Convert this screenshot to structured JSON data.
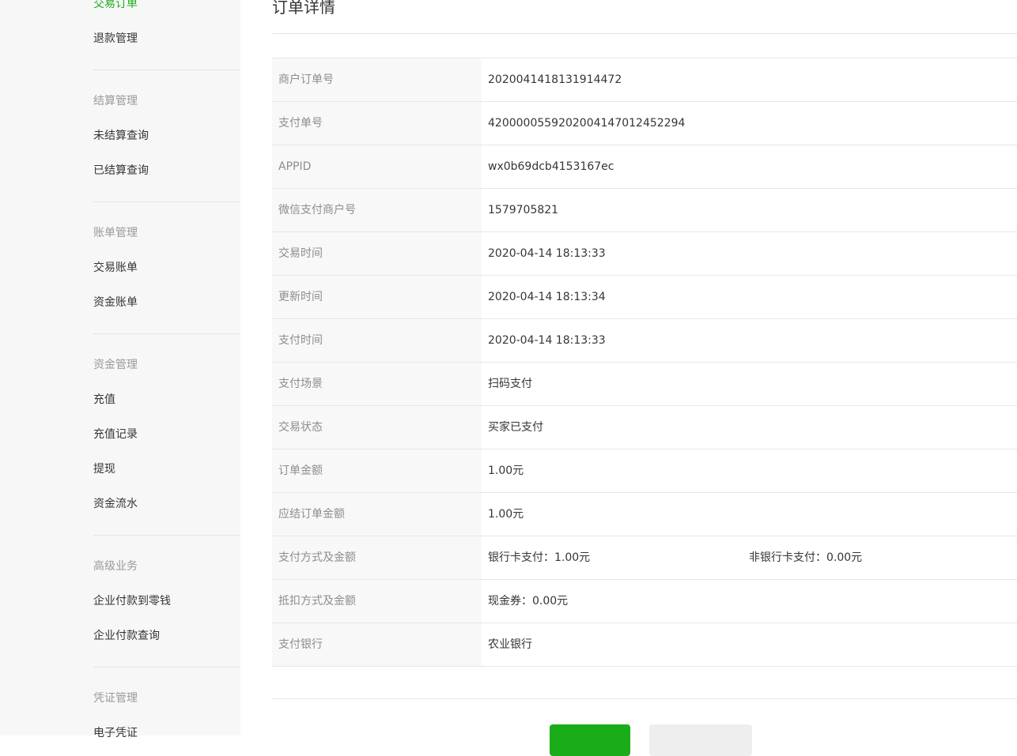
{
  "sidebar": {
    "top_items": [
      "交易订单",
      "退款管理"
    ],
    "groups": [
      {
        "title": "结算管理",
        "items": [
          "未结算查询",
          "已结算查询"
        ]
      },
      {
        "title": "账单管理",
        "items": [
          "交易账单",
          "资金账单"
        ]
      },
      {
        "title": "资金管理",
        "items": [
          "充值",
          "充值记录",
          "提现",
          "资金流水"
        ]
      },
      {
        "title": "高级业务",
        "items": [
          "企业付款到零钱",
          "企业付款查询"
        ]
      },
      {
        "title": "凭证管理",
        "items": [
          "电子凭证"
        ]
      }
    ],
    "active_color": "#1aad19"
  },
  "page": {
    "title": "订单详情"
  },
  "details": [
    {
      "label": "商户订单号",
      "value": "2020041418131914472"
    },
    {
      "label": "支付单号",
      "value": "4200000559202004147012452294"
    },
    {
      "label": "APPID",
      "value": "wx0b69dcb4153167ec"
    },
    {
      "label": "微信支付商户号",
      "value": "1579705821"
    },
    {
      "label": "交易时间",
      "value": "2020-04-14 18:13:33"
    },
    {
      "label": "更新时间",
      "value": "2020-04-14 18:13:34"
    },
    {
      "label": "支付时间",
      "value": "2020-04-14 18:13:33"
    },
    {
      "label": "支付场景",
      "value": "扫码支付"
    },
    {
      "label": "交易状态",
      "value": "买家已支付"
    },
    {
      "label": "订单金额",
      "value": "1.00元"
    },
    {
      "label": "应结订单金额",
      "value": "1.00元"
    },
    {
      "label": "支付方式及金额",
      "value": "银行卡支付：1.00元",
      "value2": "非银行卡支付：0.00元"
    },
    {
      "label": "抵扣方式及金额",
      "value": "现金券：0.00元"
    },
    {
      "label": "支付银行",
      "value": "农业银行"
    }
  ],
  "buttons": {
    "primary_color": "#1aad19",
    "default_color": "#eeeeee"
  }
}
